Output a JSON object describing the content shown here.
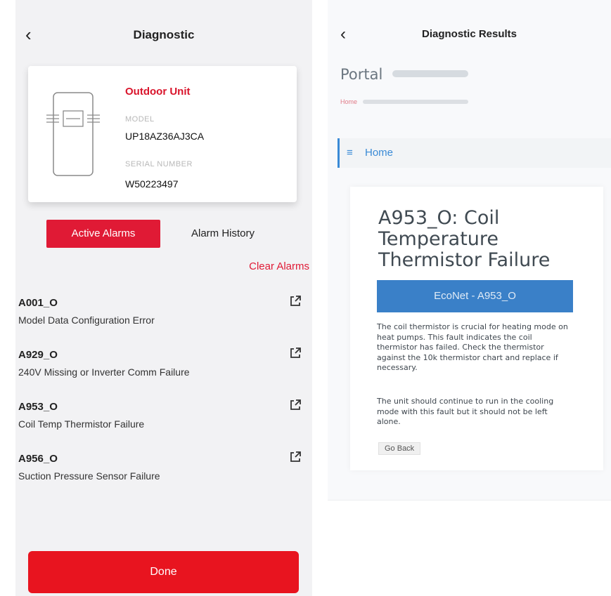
{
  "left": {
    "header": {
      "back_icon": "chevron-left-icon",
      "title": "Diagnostic"
    },
    "unit_card": {
      "title": "Outdoor Unit",
      "model_label": "MODEL",
      "model_value": "UP18AZ36AJ3CA",
      "serial_label": "SERIAL NUMBER",
      "serial_value": "W50223497",
      "image_icon": "outdoor-unit-icon"
    },
    "tabs": {
      "active": "Active Alarms",
      "inactive": "Alarm History"
    },
    "clear_label": "Clear Alarms",
    "alarms": [
      {
        "code": "A001_O",
        "desc": "Model Data Configuration Error"
      },
      {
        "code": "A929_O",
        "desc": "240V Missing or Inverter Comm Failure"
      },
      {
        "code": "A953_O",
        "desc": "Coil Temp Thermistor Failure"
      },
      {
        "code": "A956_O",
        "desc": "Suction Pressure Sensor Failure"
      }
    ],
    "done_label": "Done"
  },
  "right": {
    "header": {
      "back_icon": "chevron-left-icon",
      "title": "Diagnostic Results"
    },
    "portal": "Portal",
    "breadcrumb": "Home",
    "home_nav": "Home",
    "menu_icon": "menu-icon",
    "article": {
      "title": "A953_O: Coil Temperature Thermistor Failure",
      "button": "EcoNet - A953_O",
      "p1": "The coil thermistor is crucial for heating mode on heat pumps. This fault indicates the coil thermistor has failed. Check the thermistor against the 10k thermistor chart and replace if necessary.",
      "p2": "The unit should continue to run in the cooling mode with this fault but it should not be left alone.",
      "go_back": "Go Back"
    }
  },
  "colors": {
    "accent": "#e01a35",
    "link_blue": "#3a8ad6",
    "button_blue": "#3a80c8"
  }
}
